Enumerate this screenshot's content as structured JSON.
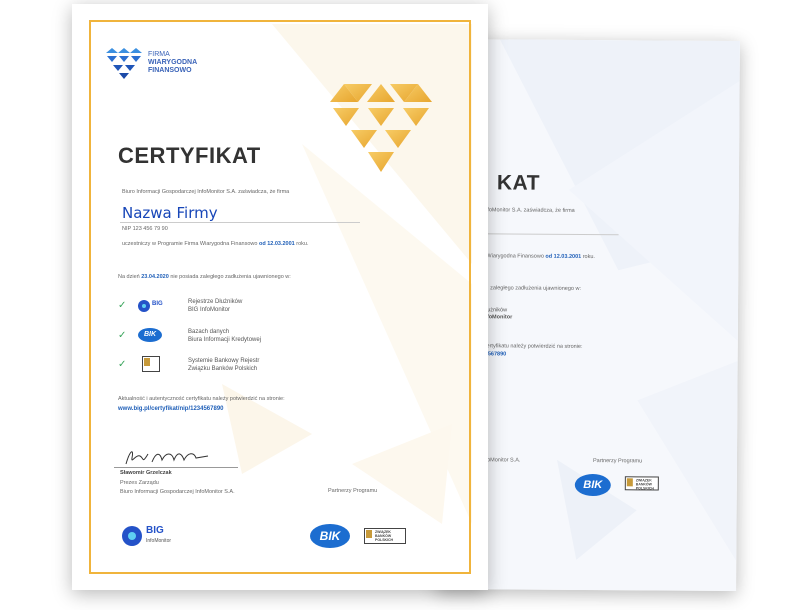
{
  "front": {
    "logo": {
      "line1": "FIRMA",
      "line2": "WIARYGODNA",
      "line3": "FINANSOWO"
    },
    "title": "CERTYFIKAT",
    "attest": "Biuro Informacji Gospodarczej InfoMonitor S.A. zaświadcza, że firma",
    "firm_name": "Nazwa Firmy",
    "nip": "NIP 123 456 79 90",
    "participation": {
      "prefix": "uczestniczy w Programie Firma Wiarygodna Finansowo",
      "date": "od 12.03.2001",
      "suffix": "roku."
    },
    "status_line": {
      "prefix": "Na dzień",
      "date": "23.04.2020",
      "suffix": "nie posiada zaległego zadłużenia ujawnionego w:"
    },
    "registries": [
      {
        "check": "✓",
        "logo": "BIG",
        "line1": "Rejestrze Dłużników",
        "line2": "BIG InfoMonitor"
      },
      {
        "check": "✓",
        "logo": "BIK",
        "line1": "Bazach danych",
        "line2": "Biura Informacji Kredytowej"
      },
      {
        "check": "✓",
        "logo": "ZBP",
        "line1": "Systemie Bankowy Rejestr",
        "line2": "Związku Banków Polskich"
      }
    ],
    "verify_text": "Aktualność i autentyczność certyfikatu należy potwierdzić na stronie:",
    "verify_url": "www.big.pl/certyfikat/nip/1234567890",
    "signer_name": "Sławomir Grzelczak",
    "signer_role": "Prezes Zarządu",
    "signer_org": "Biuro Informacji Gospodarczej InfoMonitor S.A.",
    "partners_label": "Partnerzy Programu",
    "footer_big": "BIG",
    "footer_big_sub": "InfoMonitor",
    "bik_label": "BIK",
    "zbp_label": "ZWIĄZEK BANKÓW POLSKICH"
  },
  "back": {
    "title_fragment": "KAT",
    "attest_fragment": "InfoMonitor S.A. zaświadcza, że firma",
    "participation_fragment": "Wiarygodna Finansowo",
    "participation_date": "od 12.03.2001",
    "participation_suffix": "roku.",
    "status_fragment": "zaległego zadłużenia ujawnionego w:",
    "reg1_line1": "Dłużników",
    "reg1_line2": "InfoMonitor",
    "verify_fragment": "certyfikatu należy potwierdzić na stronie:",
    "url_fragment": "34567890",
    "org_fragment": "InfoMonitor S.A.",
    "partners_label": "Partnerzy Programu",
    "bik_label": "BIK",
    "zbp_label": "ZWIĄZEK BANKÓW POLSKICH"
  },
  "colors": {
    "gold": "#f0b43c",
    "blue": "#1f5fb8",
    "check": "#3aa55c"
  }
}
